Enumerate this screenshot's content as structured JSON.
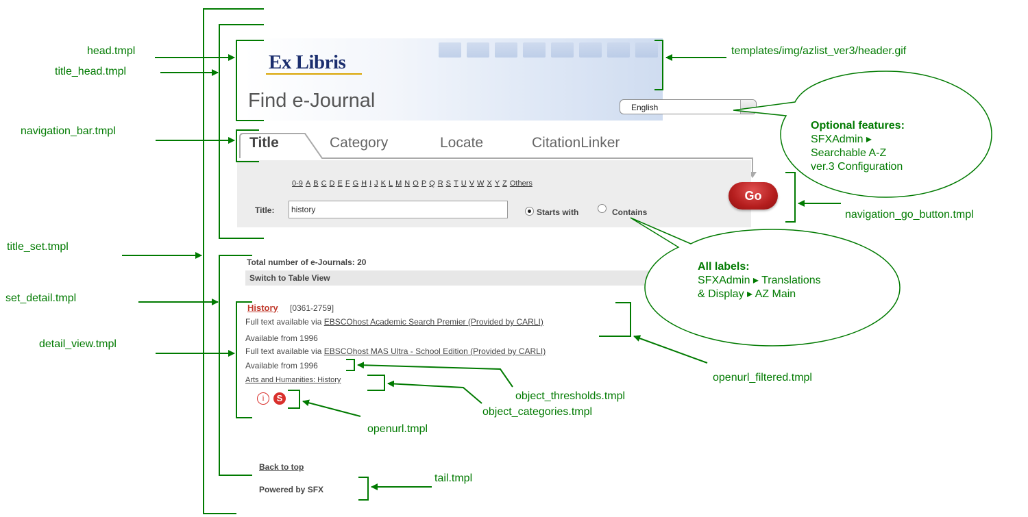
{
  "labels": {
    "head": "head.tmpl",
    "title_head": "title_head.tmpl",
    "navigation_bar": "navigation_bar.tmpl",
    "title_set": "title_set.tmpl",
    "set_detail": "set_detail.tmpl",
    "detail_view": "detail_view.tmpl",
    "header_gif": "templates/img/azlist_ver3/header.gif",
    "navigation_go_button": "navigation_go_button.tmpl",
    "openurl_filtered": "openurl_filtered.tmpl",
    "object_thresholds": "object_thresholds.tmpl",
    "object_categories": "object_categories.tmpl",
    "openurl": "openurl.tmpl",
    "tail": "tail.tmpl"
  },
  "bubbles": {
    "optional": {
      "heading": "Optional features:",
      "line1": "SFXAdmin ▸",
      "line2": "Searchable A-Z",
      "line3": "ver.3 Configuration"
    },
    "labels": {
      "heading": "All labels:",
      "line1": "SFXAdmin ▸ Translations",
      "line2": "& Display ▸ AZ Main"
    }
  },
  "screen": {
    "logo": "Ex Libris",
    "page_title": "Find e-Journal",
    "language": "English",
    "tabs": [
      "Title",
      "Category",
      "Locate",
      "CitationLinker"
    ],
    "alphabet": [
      "0-9",
      "A",
      "B",
      "C",
      "D",
      "E",
      "F",
      "G",
      "H",
      "I",
      "J",
      "K",
      "L",
      "M",
      "N",
      "O",
      "P",
      "Q",
      "R",
      "S",
      "T",
      "U",
      "V",
      "W",
      "X",
      "Y",
      "Z",
      "Others"
    ],
    "title_field_label": "Title:",
    "title_field_value": "history",
    "radio_starts": "Starts with",
    "radio_contains": "Contains",
    "go_label": "Go",
    "total": "Total number of e-Journals: 20",
    "switch_view": "Switch to Table View",
    "journal_title": "History",
    "issn": "[0361-2759]",
    "fulltext_prefix": "Full text available via",
    "service1": "EBSCOhost Academic Search Premier (Provided by CARLI)",
    "avail1": "Available from 1996",
    "service2": "EBSCOhost MAS Ultra - School Edition (Provided by CARLI)",
    "avail2": "Available from 1996",
    "category": "Arts and Humanities: History",
    "info_icon": "info-icon",
    "sfx_icon": "sfx-icon",
    "back_to_top": "Back to top",
    "powered_by": "Powered by SFX"
  },
  "colors": {
    "annotation": "#007a00",
    "bubble_fill": "#ffffff",
    "go_button": "#b51e1e",
    "link_red": "#c0392b"
  }
}
